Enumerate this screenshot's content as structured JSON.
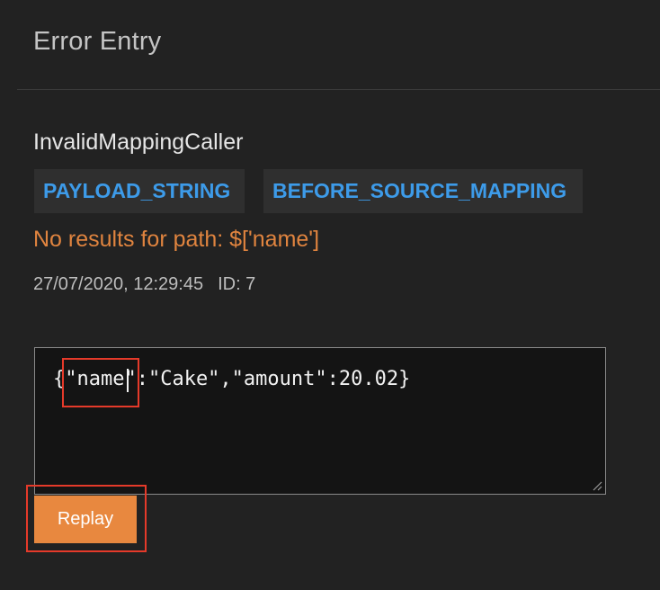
{
  "header": {
    "title": "Error Entry"
  },
  "error": {
    "name": "InvalidMappingCaller",
    "tags": [
      "PAYLOAD_STRING",
      "BEFORE_SOURCE_MAPPING"
    ],
    "message": "No results for path: $['name']",
    "timestamp": "27/07/2020, 12:29:45",
    "id_label": "ID: 7"
  },
  "payload": {
    "value": "{\"name\":\"Cake\",\"amount\":20.02}"
  },
  "actions": {
    "replay_label": "Replay"
  },
  "colors": {
    "background": "#222222",
    "tag_text": "#3d9be9",
    "error_text": "#e0843f",
    "button_bg": "#e8883f",
    "annotation": "#e53a2a"
  }
}
